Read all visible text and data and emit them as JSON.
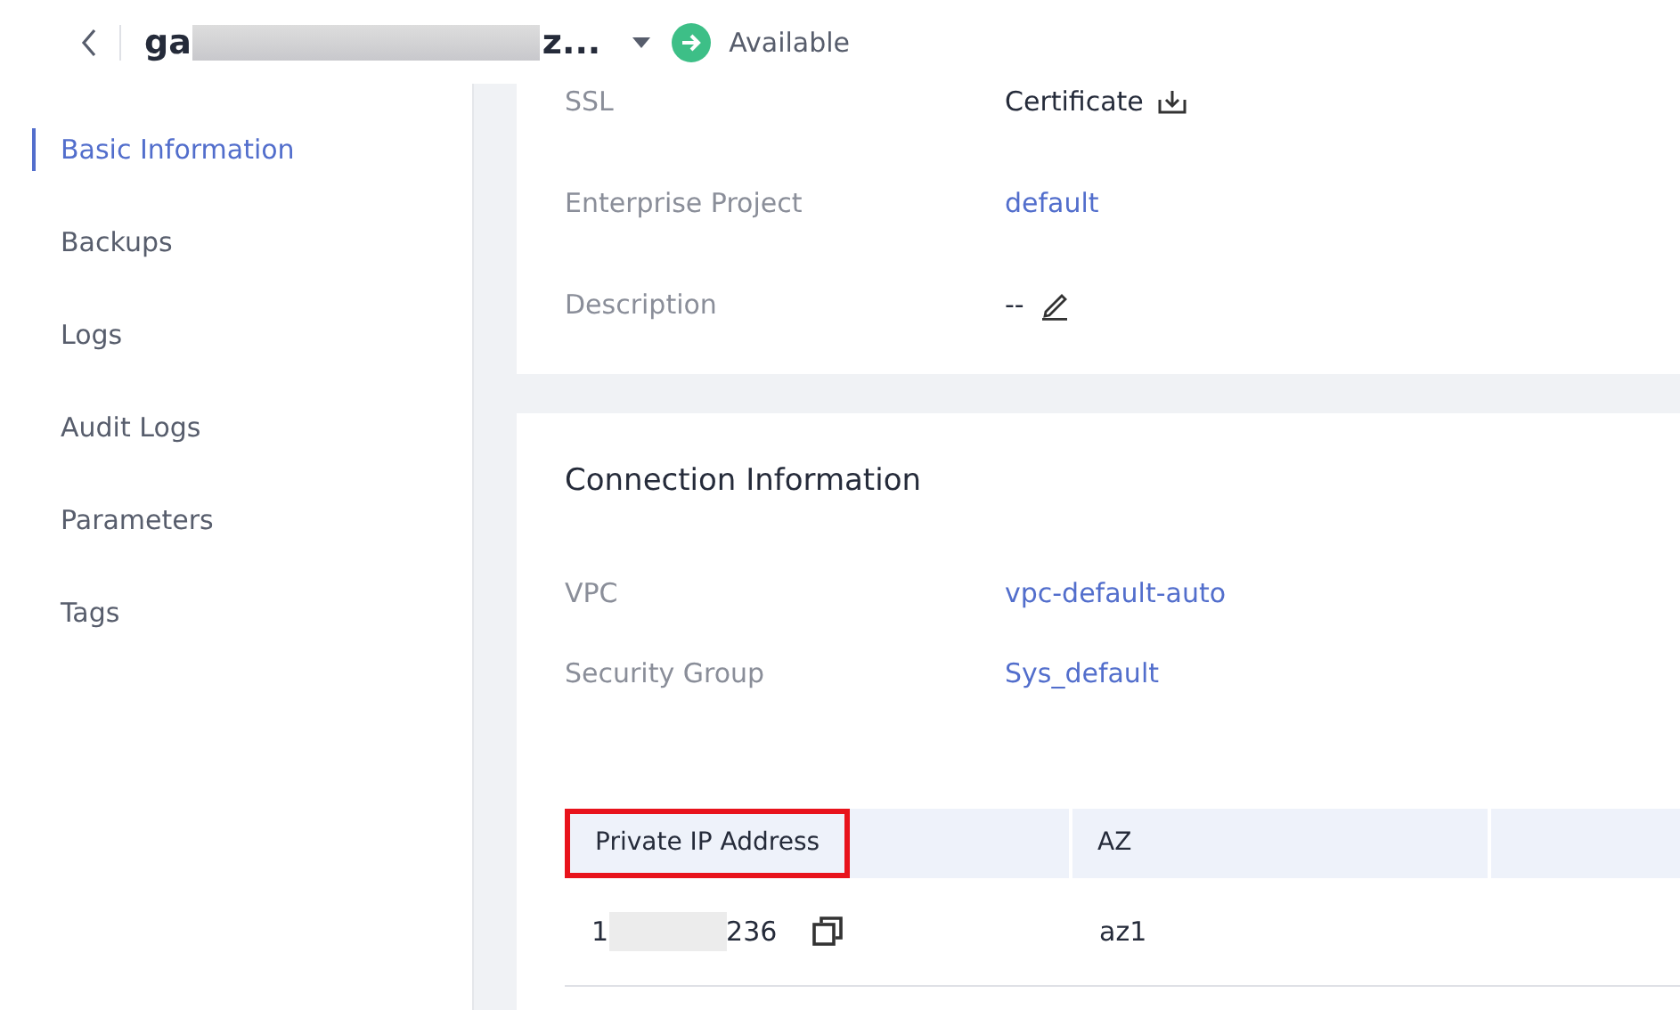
{
  "header": {
    "title_start": "ga",
    "title_end": "z...",
    "status": "Available"
  },
  "sidebar": {
    "items": [
      {
        "label": "Basic Information",
        "selected": true
      },
      {
        "label": "Backups",
        "selected": false
      },
      {
        "label": "Logs",
        "selected": false
      },
      {
        "label": "Audit Logs",
        "selected": false
      },
      {
        "label": "Parameters",
        "selected": false
      },
      {
        "label": "Tags",
        "selected": false
      }
    ]
  },
  "basic_card": {
    "rows": [
      {
        "label": "SSL",
        "value": "Certificate",
        "kind": "download"
      },
      {
        "label": "Enterprise Project",
        "value": "default",
        "kind": "link"
      },
      {
        "label": "Description",
        "value": "--",
        "kind": "edit"
      }
    ]
  },
  "connection_card": {
    "title": "Connection Information",
    "rows": [
      {
        "label": "VPC",
        "value": "vpc-default-auto",
        "kind": "link"
      },
      {
        "label": "Security Group",
        "value": "Sys_default",
        "kind": "link"
      }
    ],
    "table": {
      "columns": [
        {
          "label": "Private IP Address",
          "highlighted": true
        },
        {
          "label": "AZ",
          "highlighted": false
        }
      ],
      "rows": [
        {
          "ip_start": "1",
          "ip_end": "236",
          "az": "az1"
        }
      ]
    }
  }
}
